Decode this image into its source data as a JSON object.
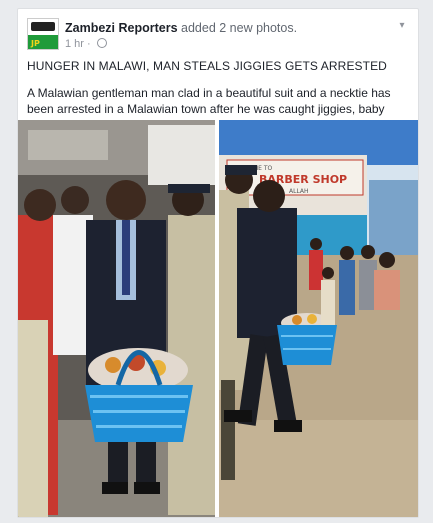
{
  "post": {
    "author": "Zambezi Reporters",
    "action": "added 2 new photos.",
    "time": "1 hr",
    "avatar_text": "JP",
    "headline": "HUNGER IN MALAWI, MAN STEALS JIGGIES GETS ARRESTED",
    "body": "A Malawian gentleman man clad in a beautiful suit and a necktie has been arrested in a Malawian town after he was caught jiggies, baby food."
  },
  "photos": {
    "left": {
      "basket_label": "",
      "description_icon": "arrest-scene-photo"
    },
    "right": {
      "sign_line1": "WELCOME TO",
      "sign_line2": "BARBER SHOP",
      "sign_line3": "ALLAH"
    }
  },
  "colors": {
    "accent_green": "#1f9b3a",
    "basket_blue": "#1e8ed6",
    "sign_red": "#c0392b"
  }
}
